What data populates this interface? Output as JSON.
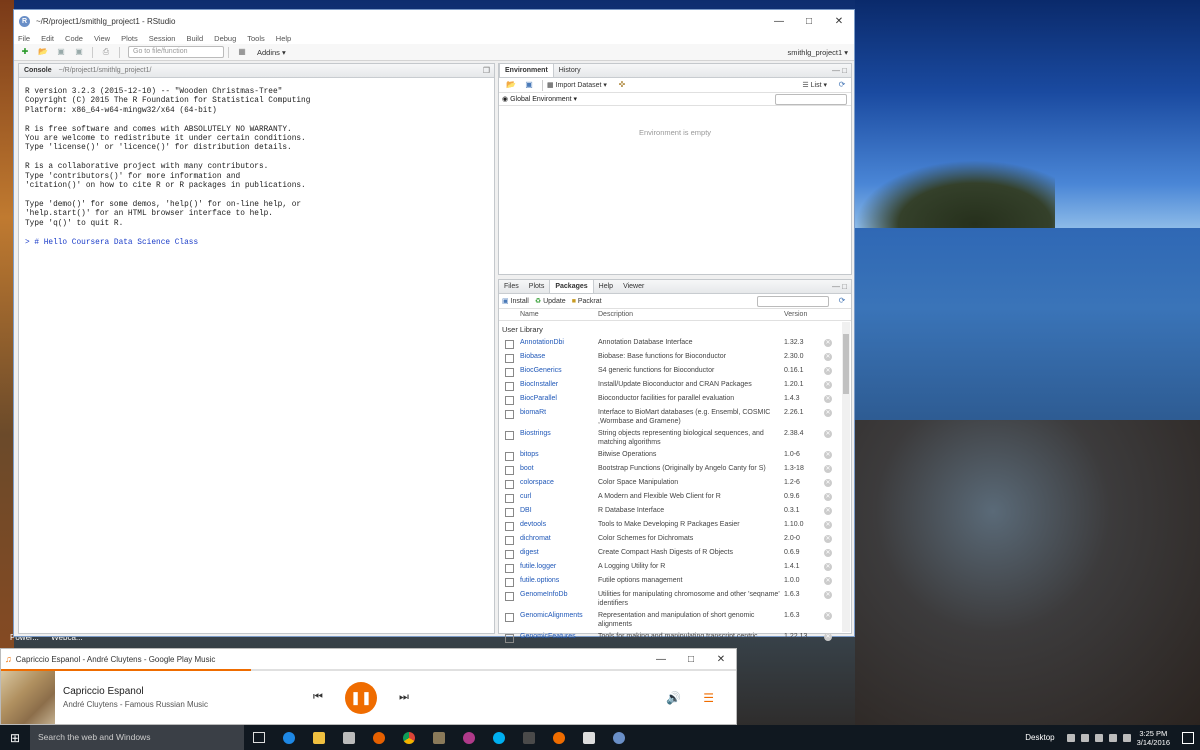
{
  "rstudio": {
    "window_title": "~/R/project1/smithlg_project1 - RStudio",
    "menu": [
      "File",
      "Edit",
      "Code",
      "View",
      "Plots",
      "Session",
      "Build",
      "Debug",
      "Tools",
      "Help"
    ],
    "goto_placeholder": "Go to file/function",
    "addins_label": "Addins",
    "project_label": "smithlg_project1",
    "console": {
      "tab_label": "Console",
      "path": "~/R/project1/smithlg_project1/",
      "output": "R version 3.2.3 (2015-12-10) -- \"Wooden Christmas-Tree\"\nCopyright (C) 2015 The R Foundation for Statistical Computing\nPlatform: x86_64-w64-mingw32/x64 (64-bit)\n\nR is free software and comes with ABSOLUTELY NO WARRANTY.\nYou are welcome to redistribute it under certain conditions.\nType 'license()' or 'licence()' for distribution details.\n\nR is a collaborative project with many contributors.\nType 'contributors()' for more information and\n'citation()' on how to cite R or R packages in publications.\n\nType 'demo()' for some demos, 'help()' for on-line help, or\n'help.start()' for an HTML browser interface to help.\nType 'q()' to quit R.",
      "prompt": "> # Hello Coursera Data Science Class"
    },
    "env": {
      "tabs": [
        "Environment",
        "History"
      ],
      "import_label": "Import Dataset",
      "list_label": "List",
      "scope_label": "Global Environment",
      "empty_text": "Environment is empty"
    },
    "files": {
      "tabs": [
        "Files",
        "Plots",
        "Packages",
        "Help",
        "Viewer"
      ],
      "install_label": "Install",
      "update_label": "Update",
      "packrat_label": "Packrat",
      "col_name": "Name",
      "col_desc": "Description",
      "col_version": "Version",
      "section": "User Library",
      "packages": [
        {
          "name": "AnnotationDbi",
          "desc": "Annotation Database Interface",
          "ver": "1.32.3"
        },
        {
          "name": "Biobase",
          "desc": "Biobase: Base functions for Bioconductor",
          "ver": "2.30.0"
        },
        {
          "name": "BiocGenerics",
          "desc": "S4 generic functions for Bioconductor",
          "ver": "0.16.1"
        },
        {
          "name": "BiocInstaller",
          "desc": "Install/Update Bioconductor and CRAN Packages",
          "ver": "1.20.1"
        },
        {
          "name": "BiocParallel",
          "desc": "Bioconductor facilities for parallel evaluation",
          "ver": "1.4.3"
        },
        {
          "name": "biomaRt",
          "desc": "Interface to BioMart databases (e.g. Ensembl, COSMIC ,Wormbase and Gramene)",
          "ver": "2.26.1"
        },
        {
          "name": "Biostrings",
          "desc": "String objects representing biological sequences, and matching algorithms",
          "ver": "2.38.4"
        },
        {
          "name": "bitops",
          "desc": "Bitwise Operations",
          "ver": "1.0-6"
        },
        {
          "name": "boot",
          "desc": "Bootstrap Functions (Originally by Angelo Canty for S)",
          "ver": "1.3-18"
        },
        {
          "name": "colorspace",
          "desc": "Color Space Manipulation",
          "ver": "1.2-6"
        },
        {
          "name": "curl",
          "desc": "A Modern and Flexible Web Client for R",
          "ver": "0.9.6"
        },
        {
          "name": "DBI",
          "desc": "R Database Interface",
          "ver": "0.3.1"
        },
        {
          "name": "devtools",
          "desc": "Tools to Make Developing R Packages Easier",
          "ver": "1.10.0"
        },
        {
          "name": "dichromat",
          "desc": "Color Schemes for Dichromats",
          "ver": "2.0-0"
        },
        {
          "name": "digest",
          "desc": "Create Compact Hash Digests of R Objects",
          "ver": "0.6.9"
        },
        {
          "name": "futile.logger",
          "desc": "A Logging Utility for R",
          "ver": "1.4.1"
        },
        {
          "name": "futile.options",
          "desc": "Futile options management",
          "ver": "1.0.0"
        },
        {
          "name": "GenomeInfoDb",
          "desc": "Utilities for manipulating chromosome and other 'seqname' identifiers",
          "ver": "1.6.3"
        },
        {
          "name": "GenomicAlignments",
          "desc": "Representation and manipulation of short genomic alignments",
          "ver": "1.6.3"
        },
        {
          "name": "GenomicFeatures",
          "desc": "Tools for making and manipulating transcript centric",
          "ver": "1.22.13"
        }
      ]
    }
  },
  "music": {
    "window_title": "Capriccio Espanol - André Cluytens - Google Play Music",
    "song": "Capriccio Espanol",
    "artist_album": "André Cluytens - Famous Russian Music",
    "progress_fraction": 0.34,
    "accent": "#ef6c00"
  },
  "desktop": {
    "icon_labels": [
      "Power...",
      "Webca..."
    ]
  },
  "taskbar": {
    "search_placeholder": "Search the web and Windows",
    "desktop_label": "Desktop",
    "time": "3:25 PM",
    "date": "3/14/2016"
  }
}
